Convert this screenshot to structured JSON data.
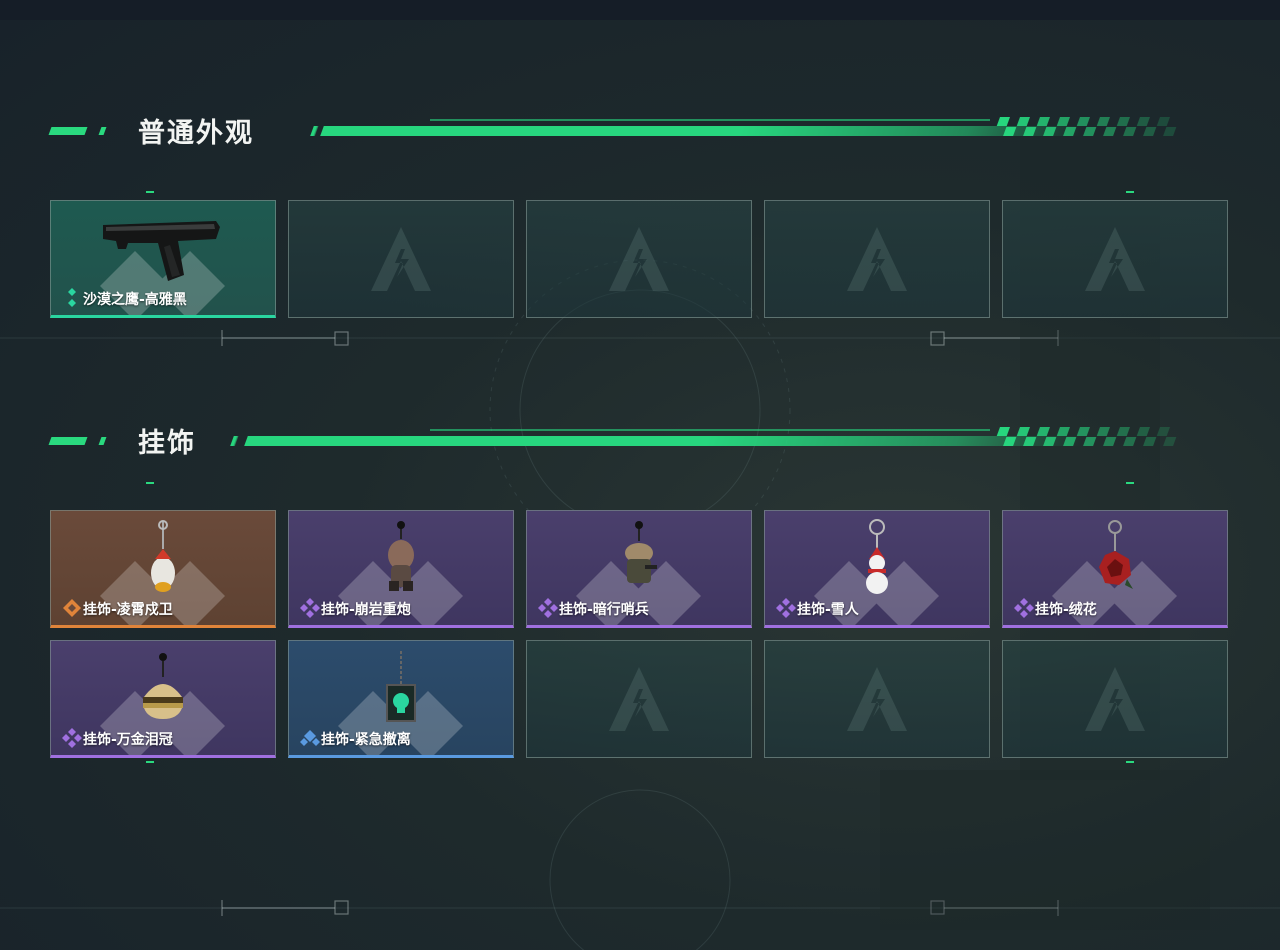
{
  "sections": {
    "appearance": {
      "title": "普通外观"
    },
    "charms": {
      "title": "挂饰"
    }
  },
  "appearance_items": [
    {
      "name": "沙漠之鹰-高雅黑",
      "rarity": "green",
      "icon": "pistol-icon"
    }
  ],
  "charm_items": [
    {
      "name": "挂饰-凌霄戍卫",
      "rarity": "orange",
      "icon": "chicken-charm-icon"
    },
    {
      "name": "挂饰-崩岩重炮",
      "rarity": "purple",
      "icon": "rock-soldier-charm-icon"
    },
    {
      "name": "挂饰-暗行哨兵",
      "rarity": "purple",
      "icon": "sentinel-charm-icon"
    },
    {
      "name": "挂饰-雪人",
      "rarity": "purple",
      "icon": "snowman-charm-icon"
    },
    {
      "name": "挂饰-绒花",
      "rarity": "purple",
      "icon": "rose-charm-icon"
    },
    {
      "name": "挂饰-万金泪冠",
      "rarity": "purple",
      "icon": "burger-crown-charm-icon"
    },
    {
      "name": "挂饰-紧急撤离",
      "rarity": "blue",
      "icon": "skull-tag-charm-icon"
    }
  ],
  "colors": {
    "accent": "#2ad97f",
    "green": "#2ad6a0",
    "orange": "#e0843a",
    "purple": "#a070e0",
    "blue": "#5a9ae0"
  }
}
